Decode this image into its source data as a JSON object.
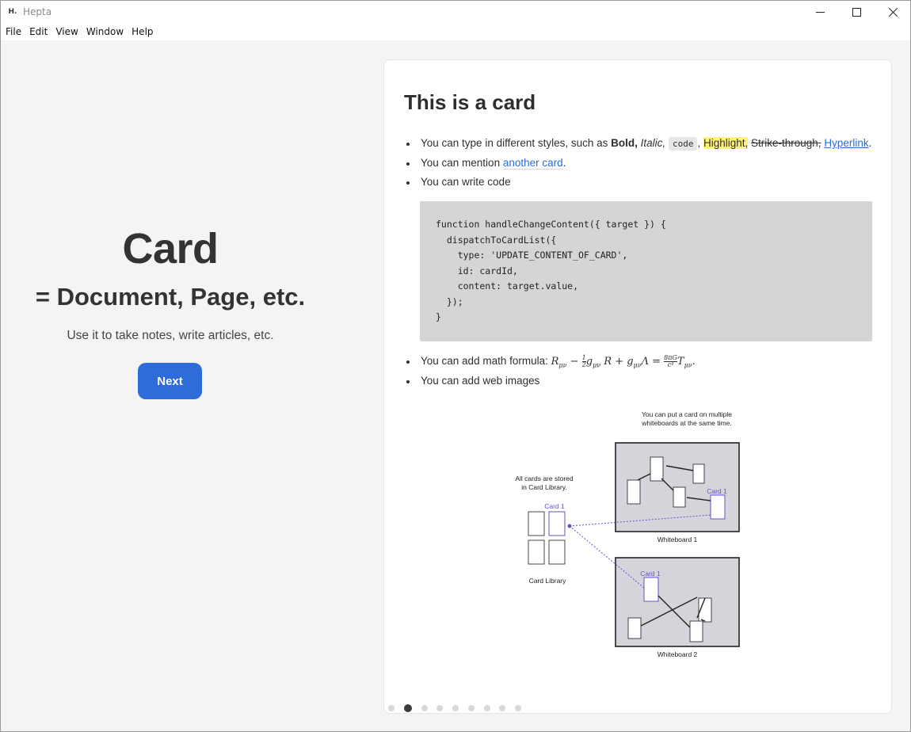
{
  "window": {
    "title": "Hepta",
    "app_icon": "H."
  },
  "menu": [
    "File",
    "Edit",
    "View",
    "Window",
    "Help"
  ],
  "intro": {
    "title": "Card",
    "subtitle": "= Document, Page, etc.",
    "description": "Use it to take notes, write articles, etc.",
    "next_label": "Next"
  },
  "card": {
    "title": "This is a card",
    "styles_bullet": {
      "prefix": "You can type in different styles, such as ",
      "bold": "Bold,",
      "italic": "Italic,",
      "code": "code",
      "highlight": "Highlight,",
      "strike": "Strike-through,",
      "link": "Hyperlink",
      "end": "."
    },
    "mention_bullet": {
      "prefix": "You can mention ",
      "mention": "another card",
      "end": "."
    },
    "code_bullet": "You can write code",
    "code_lines": [
      "function handleChangeContent({ target }) {",
      "  dispatchToCardList({",
      "    type: 'UPDATE_CONTENT_OF_CARD',",
      "    id: cardId,",
      "    content: target.value,",
      "  });",
      "}"
    ],
    "math_bullet": "You can add math formula: ",
    "image_bullet": "You can add web images",
    "diagram": {
      "note_top": [
        "You can put a card on multiple",
        "whiteboards at the same time."
      ],
      "note_left": [
        "All cards are stored",
        "in Card Library."
      ],
      "card_label": "Card 1",
      "library_label": "Card Library",
      "whiteboard1": "Whiteboard 1",
      "whiteboard2": "Whiteboard 2"
    }
  },
  "pagination": {
    "total": 9,
    "active_index": 1
  }
}
